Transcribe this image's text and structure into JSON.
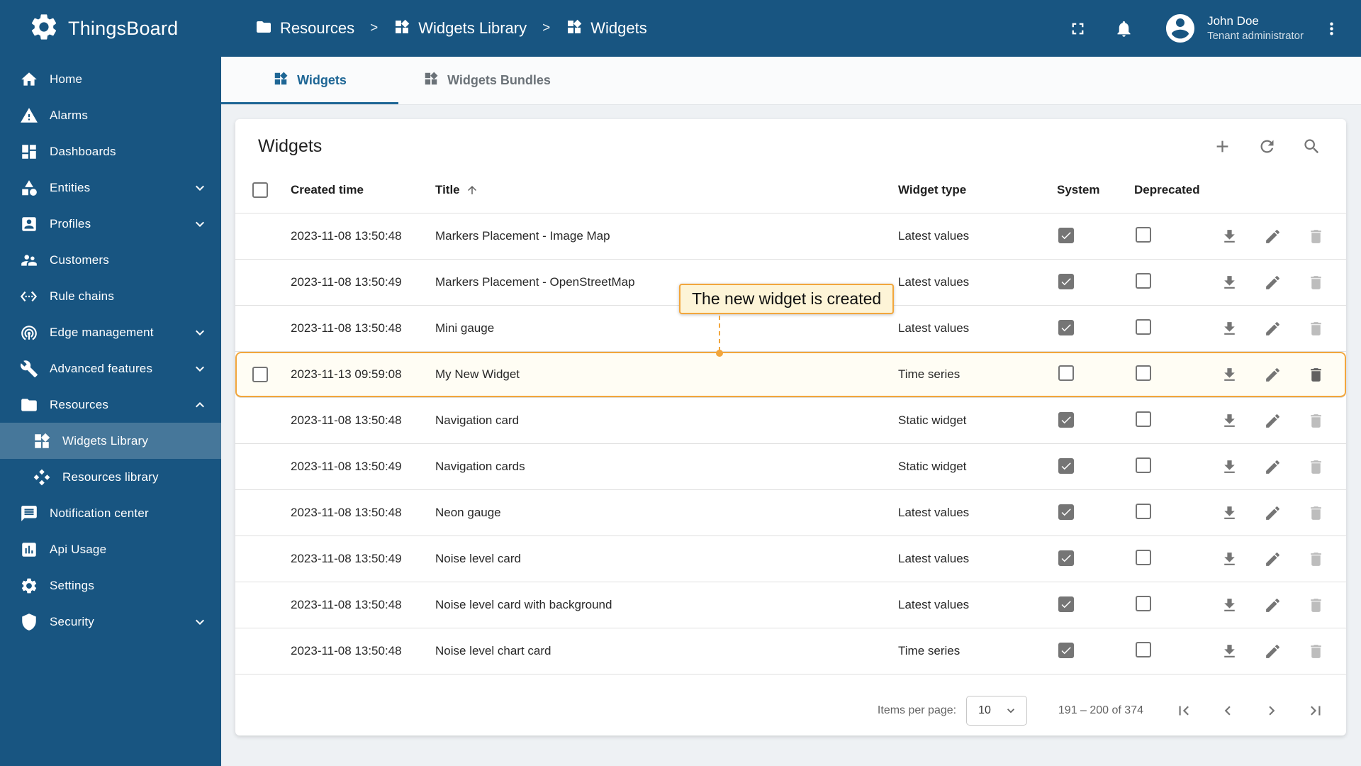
{
  "brand": {
    "name": "ThingsBoard",
    "logo_icon": "gear"
  },
  "breadcrumb": [
    {
      "label": "Resources",
      "icon": "folder"
    },
    {
      "label": "Widgets Library",
      "icon": "widgets"
    },
    {
      "label": "Widgets",
      "icon": "widgets"
    }
  ],
  "topbar": {
    "icons": [
      "fullscreen",
      "notifications",
      "account-circle",
      "more-vert"
    ]
  },
  "user": {
    "name": "John Doe",
    "role": "Tenant administrator"
  },
  "sidebar": {
    "items": [
      {
        "label": "Home",
        "icon": "home"
      },
      {
        "label": "Alarms",
        "icon": "warning"
      },
      {
        "label": "Dashboards",
        "icon": "dashboard"
      },
      {
        "label": "Entities",
        "icon": "entities",
        "expandable": true
      },
      {
        "label": "Profiles",
        "icon": "profiles",
        "expandable": true
      },
      {
        "label": "Customers",
        "icon": "customers"
      },
      {
        "label": "Rule chains",
        "icon": "rule-chains"
      },
      {
        "label": "Edge management",
        "icon": "edge",
        "expandable": true
      },
      {
        "label": "Advanced features",
        "icon": "advanced",
        "expandable": true
      },
      {
        "label": "Resources",
        "icon": "folder",
        "expandable": true,
        "expanded": true
      },
      {
        "label": "Widgets Library",
        "icon": "widgets",
        "child": true,
        "active": true
      },
      {
        "label": "Resources library",
        "icon": "resources-lib",
        "child": true
      },
      {
        "label": "Notification center",
        "icon": "notification"
      },
      {
        "label": "Api Usage",
        "icon": "api"
      },
      {
        "label": "Settings",
        "icon": "settings"
      },
      {
        "label": "Security",
        "icon": "security",
        "expandable": true
      }
    ]
  },
  "tabs": [
    {
      "label": "Widgets",
      "active": true
    },
    {
      "label": "Widgets Bundles",
      "active": false
    }
  ],
  "card": {
    "title": "Widgets",
    "tools": [
      "add",
      "refresh",
      "search"
    ]
  },
  "table": {
    "columns": [
      "Created time",
      "Title",
      "Widget type",
      "System",
      "Deprecated"
    ],
    "sort": {
      "column": "Title",
      "direction": "asc"
    },
    "rows": [
      {
        "created": "2023-11-08 13:50:48",
        "title": "Markers Placement - Image Map",
        "widget_type": "Latest values",
        "system": true,
        "deprecated": false
      },
      {
        "created": "2023-11-08 13:50:49",
        "title": "Markers Placement - OpenStreetMap",
        "widget_type": "Latest values",
        "system": true,
        "deprecated": false
      },
      {
        "created": "2023-11-08 13:50:48",
        "title": "Mini gauge",
        "widget_type": "Latest values",
        "system": true,
        "deprecated": false
      },
      {
        "created": "2023-11-13 09:59:08",
        "title": "My New Widget",
        "widget_type": "Time series",
        "system": false,
        "deprecated": false,
        "highlighted": true
      },
      {
        "created": "2023-11-08 13:50:48",
        "title": "Navigation card",
        "widget_type": "Static widget",
        "system": true,
        "deprecated": false
      },
      {
        "created": "2023-11-08 13:50:49",
        "title": "Navigation cards",
        "widget_type": "Static widget",
        "system": true,
        "deprecated": false
      },
      {
        "created": "2023-11-08 13:50:48",
        "title": "Neon gauge",
        "widget_type": "Latest values",
        "system": true,
        "deprecated": false
      },
      {
        "created": "2023-11-08 13:50:49",
        "title": "Noise level card",
        "widget_type": "Latest values",
        "system": true,
        "deprecated": false
      },
      {
        "created": "2023-11-08 13:50:48",
        "title": "Noise level card with background",
        "widget_type": "Latest values",
        "system": true,
        "deprecated": false
      },
      {
        "created": "2023-11-08 13:50:48",
        "title": "Noise level chart card",
        "widget_type": "Time series",
        "system": true,
        "deprecated": false
      }
    ]
  },
  "callout": {
    "text": "The new widget is created"
  },
  "paginator": {
    "items_per_page_label": "Items per page:",
    "page_size": "10",
    "range_label": "191 – 200 of 374"
  }
}
